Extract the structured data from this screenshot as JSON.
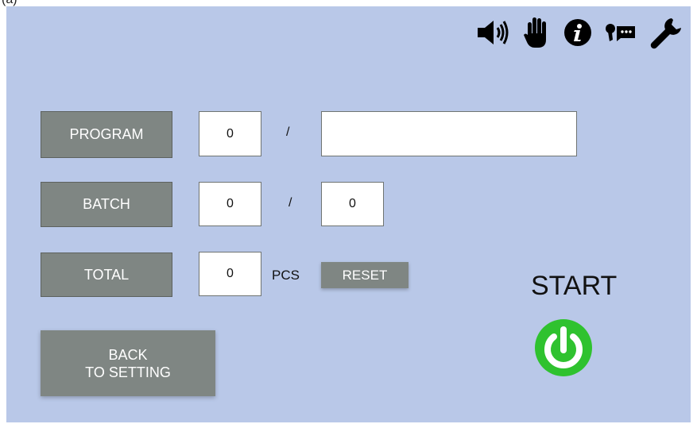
{
  "corner_label": "(a)",
  "toolbar": {
    "icons": [
      "speaker-icon",
      "hand-icon",
      "info-icon",
      "speech-icon",
      "wrench-icon"
    ]
  },
  "program": {
    "label": "PROGRAM",
    "value": "0",
    "separator": "/",
    "name": ""
  },
  "batch": {
    "label": "BATCH",
    "value": "0",
    "separator": "/",
    "target": "0"
  },
  "total": {
    "label": "TOTAL",
    "value": "0",
    "unit": "PCS",
    "reset_label": "RESET"
  },
  "back": {
    "line1": "BACK",
    "line2": "TO SETTING"
  },
  "start": {
    "label": "START",
    "icon": "power-icon",
    "color": "#2fc22f"
  },
  "colors": {
    "panel": "#b9c8e8",
    "button": "#7f8683"
  }
}
